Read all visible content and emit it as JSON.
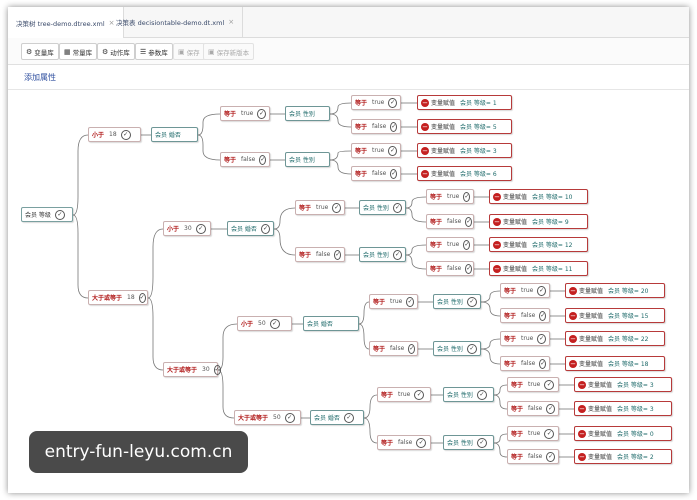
{
  "tabs": [
    {
      "label": "决策树 tree-demo.dtree.xml",
      "close": "×"
    },
    {
      "label": "决策表 decisiontable-demo.dt.xml",
      "close": "×"
    }
  ],
  "toolbar": {
    "var_lib": "变量库",
    "const_lib": "常量库",
    "action_lib": "动作库",
    "param_lib": "参数库",
    "save": "保存",
    "save_new_version": "保存新版本"
  },
  "subtitle": "添加属性",
  "tree": {
    "root": "会员 等级",
    "cond_ops": {
      "lt": "小于",
      "ge": "大于或等于",
      "eq": "等于"
    },
    "lt_18": "18",
    "ge_18": "18",
    "lt_30": "30",
    "ge_30": "30",
    "lt_50": "50",
    "ge_50": "50",
    "married": "会员 婚否",
    "gender": "会员 性别",
    "true": "true",
    "false": "false",
    "action_name": "变量赋值",
    "actions": [
      "会员 等级= 1",
      "会员 等级= 5",
      "会员 等级= 3",
      "会员 等级= 6",
      "会员 等级= 10",
      "会员 等级= 9",
      "会员 等级= 12",
      "会员 等级= 11",
      "会员 等级= 20",
      "会员 等级= 15",
      "会员 等级= 22",
      "会员 等级= 18",
      "会员 等级= 3",
      "会员 等级= 3",
      "会员 等级= 0",
      "会员 等级= 2"
    ]
  },
  "watermark": "entry-fun-leyu.com.cn",
  "colors": {
    "cond_red": "#b01818",
    "action_red": "#c42020",
    "teal": "#1e6a6a",
    "link": "#2f4f9f"
  }
}
